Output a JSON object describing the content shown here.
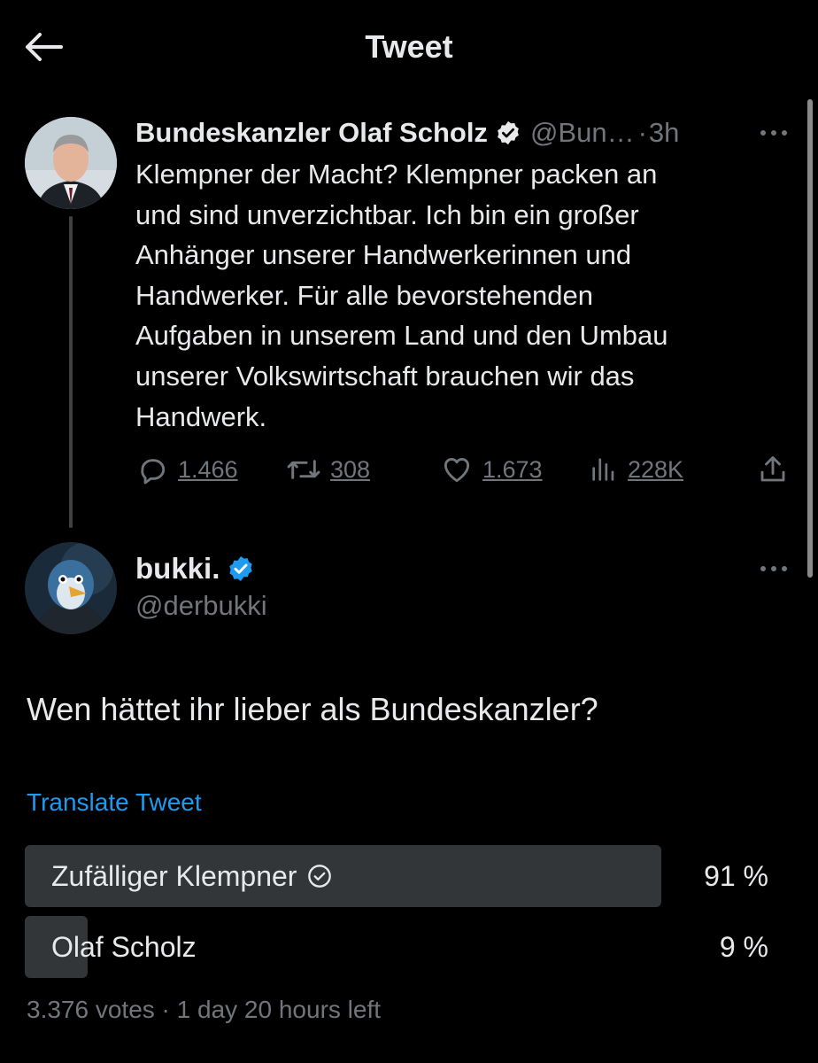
{
  "header": {
    "title": "Tweet"
  },
  "parent_tweet": {
    "display_name": "Bundeskanzler Olaf Scholz",
    "handle": "@Bun…",
    "separator": "·",
    "time": "3h",
    "text": "Klempner der Macht? Klempner packen an\nund sind unverzichtbar. Ich bin ein großer\nAnhänger unserer Handwerkerinnen und\nHandwerker. Für alle bevorstehenden\nAufgaben in unserem Land und den Umbau\nunserer Volkswirtschaft brauchen wir das\nHandwerk.",
    "stats": {
      "replies": "1.466",
      "retweets": "308",
      "likes": "1.673",
      "views": "228K"
    }
  },
  "reply_tweet": {
    "display_name": "bukki.",
    "handle": "@derbukki",
    "text": "Wen hättet ihr lieber als Bundeskanzler?",
    "translate_label": "Translate Tweet",
    "poll": {
      "options": [
        {
          "label": "Zufälliger Klempner",
          "percent_text": "91 %",
          "share": 0.91,
          "selected": true
        },
        {
          "label": "Olaf Scholz",
          "percent_text": "9 %",
          "share": 0.09,
          "selected": false
        }
      ],
      "meta": "3.376 votes · 1 day 20 hours left"
    }
  },
  "colors": {
    "background": "#000000",
    "text_primary": "#e7e9ea",
    "text_secondary": "#71767b",
    "accent": "#1d9bf0",
    "poll_bar": "#333639"
  }
}
